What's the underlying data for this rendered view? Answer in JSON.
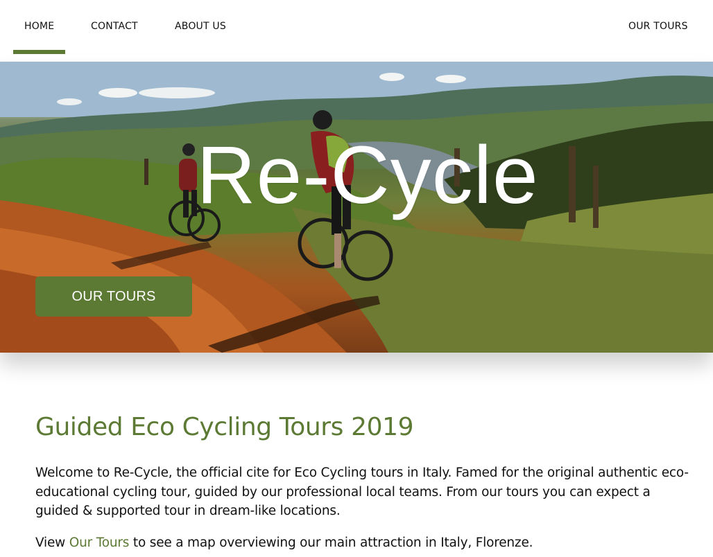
{
  "nav": {
    "items": [
      {
        "label": "HOME",
        "active": true
      },
      {
        "label": "CONTACT",
        "active": false
      },
      {
        "label": "ABOUT US",
        "active": false
      }
    ],
    "right_item": {
      "label": "OUR TOURS"
    }
  },
  "hero": {
    "title": "Re-Cycle",
    "button_label": "OUR TOURS"
  },
  "content": {
    "heading": "Guided Eco Cycling Tours 2019",
    "paragraph1": "Welcome to Re-Cycle, the official cite for Eco Cycling tours in Italy. Famed for the original authentic eco-educational cycling tour, guided by our professional local teams. From our tours you can expect a guided & supported tour in dream-like locations.",
    "paragraph2_prefix": "View ",
    "paragraph2_link": "Our Tours",
    "paragraph2_suffix": " to see a map overviewing our main attraction in Italy, Florenze."
  },
  "colors": {
    "accent": "#5c7a34",
    "text": "#111111",
    "background": "#ffffff"
  }
}
